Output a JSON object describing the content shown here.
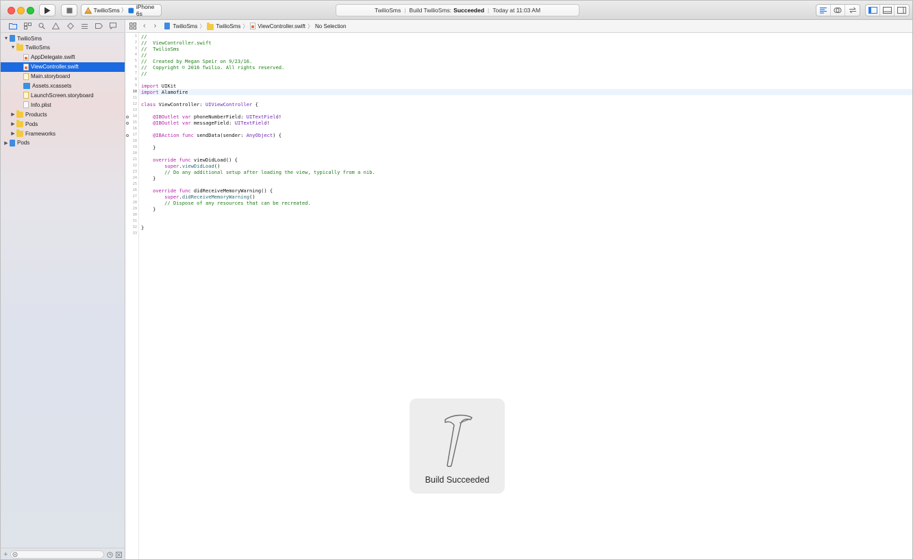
{
  "toolbar": {
    "scheme_name": "TwilioSms",
    "device_name": "iPhone 6s"
  },
  "activity": {
    "project": "TwilioSms",
    "status_prefix": "Build TwilioSms:",
    "status_result": "Succeeded",
    "time": "Today at 11:03 AM"
  },
  "navigator": {
    "items": [
      {
        "label": "TwilioSms",
        "kind": "proj",
        "depth": 0,
        "disclosure": "open"
      },
      {
        "label": "TwilioSms",
        "kind": "folder",
        "depth": 1,
        "disclosure": "open"
      },
      {
        "label": "AppDelegate.swift",
        "kind": "swift",
        "depth": 2,
        "disclosure": ""
      },
      {
        "label": "ViewController.swift",
        "kind": "swift",
        "depth": 2,
        "disclosure": "",
        "selected": true
      },
      {
        "label": "Main.storyboard",
        "kind": "sb",
        "depth": 2,
        "disclosure": ""
      },
      {
        "label": "Assets.xcassets",
        "kind": "assets",
        "depth": 2,
        "disclosure": ""
      },
      {
        "label": "LaunchScreen.storyboard",
        "kind": "sb",
        "depth": 2,
        "disclosure": ""
      },
      {
        "label": "Info.plist",
        "kind": "plist",
        "depth": 2,
        "disclosure": ""
      },
      {
        "label": "Products",
        "kind": "folder",
        "depth": 1,
        "disclosure": "closed"
      },
      {
        "label": "Pods",
        "kind": "folder",
        "depth": 1,
        "disclosure": "closed"
      },
      {
        "label": "Frameworks",
        "kind": "folder",
        "depth": 1,
        "disclosure": "closed"
      },
      {
        "label": "Pods",
        "kind": "proj",
        "depth": 0,
        "disclosure": "closed"
      }
    ]
  },
  "jumpbar": {
    "crumbs": [
      "TwilioSms",
      "TwilioSms",
      "ViewController.swift",
      "No Selection"
    ]
  },
  "editor": {
    "current_line": 10,
    "outlet_lines": [
      14,
      15,
      17
    ],
    "lines": [
      [
        [
          "//",
          "cm"
        ]
      ],
      [
        [
          "//  ViewController.swift",
          "cm"
        ]
      ],
      [
        [
          "//  TwilioSms",
          "cm"
        ]
      ],
      [
        [
          "//",
          "cm"
        ]
      ],
      [
        [
          "//  Created by Megan Speir on 9/23/16.",
          "cm"
        ]
      ],
      [
        [
          "//  Copyright © 2016 Twilio. All rights reserved.",
          "cm"
        ]
      ],
      [
        [
          "//",
          "cm"
        ]
      ],
      [],
      [
        [
          "import",
          "kw"
        ],
        [
          " UIKit",
          ""
        ]
      ],
      [
        [
          "import",
          "kw"
        ],
        [
          " Alamofire",
          ""
        ]
      ],
      [],
      [
        [
          "class",
          "kw"
        ],
        [
          " ViewController: ",
          ""
        ],
        [
          "UIViewController",
          "ty"
        ],
        [
          " {",
          ""
        ]
      ],
      [],
      [
        [
          "    @IBOutlet",
          "kw"
        ],
        [
          " ",
          ""
        ],
        [
          "var",
          "kw"
        ],
        [
          " phoneNumberField: ",
          ""
        ],
        [
          "UITextField",
          "ty"
        ],
        [
          "!",
          ""
        ]
      ],
      [
        [
          "    @IBOutlet",
          "kw"
        ],
        [
          " ",
          ""
        ],
        [
          "var",
          "kw"
        ],
        [
          " messageField: ",
          ""
        ],
        [
          "UITextField",
          "ty"
        ],
        [
          "!",
          ""
        ]
      ],
      [],
      [
        [
          "    @IBAction",
          "kw"
        ],
        [
          " ",
          ""
        ],
        [
          "func",
          "kw"
        ],
        [
          " sendData(sender: ",
          ""
        ],
        [
          "AnyObject",
          "ty"
        ],
        [
          ") {",
          ""
        ]
      ],
      [],
      [
        [
          "    }",
          ""
        ]
      ],
      [],
      [
        [
          "    override",
          "kw"
        ],
        [
          " ",
          ""
        ],
        [
          "func",
          "kw"
        ],
        [
          " viewDidLoad() {",
          ""
        ]
      ],
      [
        [
          "        super",
          "kw"
        ],
        [
          ".",
          ""
        ],
        [
          "viewDidLoad",
          "fn"
        ],
        [
          "()",
          ""
        ]
      ],
      [
        [
          "        // Do any additional setup after loading the view, typically from a nib.",
          "cm"
        ]
      ],
      [
        [
          "    }",
          ""
        ]
      ],
      [],
      [
        [
          "    override",
          "kw"
        ],
        [
          " ",
          ""
        ],
        [
          "func",
          "kw"
        ],
        [
          " didReceiveMemoryWarning() {",
          ""
        ]
      ],
      [
        [
          "        super",
          "kw"
        ],
        [
          ".",
          ""
        ],
        [
          "didReceiveMemoryWarning",
          "fn"
        ],
        [
          "()",
          ""
        ]
      ],
      [
        [
          "        // Dispose of any resources that can be recreated.",
          "cm"
        ]
      ],
      [
        [
          "    }",
          ""
        ]
      ],
      [],
      [],
      [
        [
          "}",
          ""
        ]
      ],
      []
    ]
  },
  "hud": {
    "message": "Build Succeeded"
  },
  "colors": {
    "selection": "#1b6ae0",
    "keyword": "#b21ca5",
    "comment": "#1b7c12",
    "type": "#6d22b5"
  }
}
